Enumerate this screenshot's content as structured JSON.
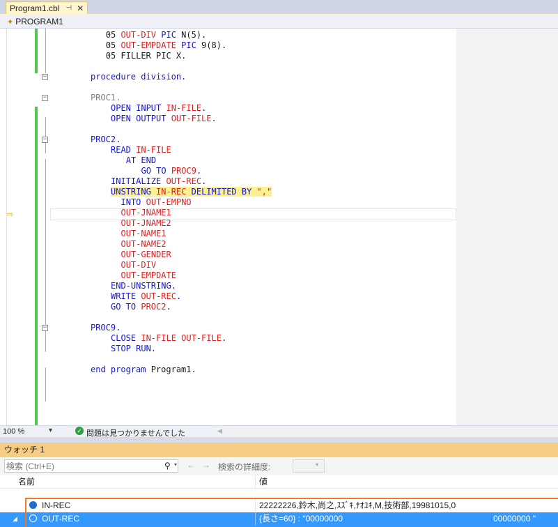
{
  "tab": {
    "title": "Program1.cbl",
    "pin_glyph": "⊣",
    "close_glyph": "✕"
  },
  "nav": {
    "scope": "PROGRAM1"
  },
  "editor": {
    "lines": [
      {
        "row": 1,
        "indent": 3,
        "segments": [
          [
            "pl",
            "05 "
          ],
          [
            "id",
            "OUT-DIV"
          ],
          [
            "kw",
            " PIC "
          ],
          [
            "pl",
            "N(5)."
          ]
        ]
      },
      {
        "row": 2,
        "indent": 3,
        "segments": [
          [
            "pl",
            "05 "
          ],
          [
            "id",
            "OUT-EMPDATE"
          ],
          [
            "kw",
            " PIC "
          ],
          [
            "pl",
            "9(8)."
          ]
        ]
      },
      {
        "row": 3,
        "indent": 3,
        "segments": [
          [
            "pl",
            "05 FILLER PIC X."
          ]
        ]
      },
      {
        "row": 5,
        "indent": 0,
        "segments": [
          [
            "kw",
            "procedure division."
          ]
        ]
      },
      {
        "row": 7,
        "indent": 0,
        "segments": [
          [
            "lb",
            "PROC1."
          ]
        ]
      },
      {
        "row": 8,
        "indent": 4,
        "segments": [
          [
            "kw",
            "OPEN INPUT "
          ],
          [
            "id",
            "IN-FILE"
          ],
          [
            "kw",
            "."
          ]
        ]
      },
      {
        "row": 9,
        "indent": 4,
        "segments": [
          [
            "kw",
            "OPEN OUTPUT "
          ],
          [
            "id",
            "OUT-FILE"
          ],
          [
            "kw",
            "."
          ]
        ]
      },
      {
        "row": 11,
        "indent": 0,
        "segments": [
          [
            "kw",
            "PROC2."
          ]
        ]
      },
      {
        "row": 12,
        "indent": 4,
        "segments": [
          [
            "kw",
            "READ "
          ],
          [
            "id",
            "IN-FILE"
          ]
        ]
      },
      {
        "row": 13,
        "indent": 7,
        "segments": [
          [
            "kw",
            "AT END"
          ]
        ]
      },
      {
        "row": 14,
        "indent": 10,
        "segments": [
          [
            "kw",
            "GO TO "
          ],
          [
            "id",
            "PROC9"
          ],
          [
            "kw",
            "."
          ]
        ]
      },
      {
        "row": 15,
        "indent": 4,
        "segments": [
          [
            "kw",
            "INITIALIZE "
          ],
          [
            "id",
            "OUT-REC"
          ],
          [
            "kw",
            "."
          ]
        ]
      },
      {
        "row": 16,
        "indent": 4,
        "highlight": true,
        "segments": [
          [
            "kw",
            "UNSTRING "
          ],
          [
            "id",
            "IN-REC"
          ],
          [
            "kw",
            " DELIMITED BY "
          ],
          [
            "id",
            "\",\""
          ]
        ]
      },
      {
        "row": 17,
        "indent": 6,
        "segments": [
          [
            "kw",
            "INTO "
          ],
          [
            "id",
            "OUT-EMPNO"
          ]
        ]
      },
      {
        "row": 18,
        "indent": 6,
        "segments": [
          [
            "id",
            "OUT-JNAME1"
          ]
        ]
      },
      {
        "row": 19,
        "indent": 6,
        "segments": [
          [
            "id",
            "OUT-JNAME2"
          ]
        ]
      },
      {
        "row": 20,
        "indent": 6,
        "segments": [
          [
            "id",
            "OUT-NAME1"
          ]
        ]
      },
      {
        "row": 21,
        "indent": 6,
        "segments": [
          [
            "id",
            "OUT-NAME2"
          ]
        ]
      },
      {
        "row": 22,
        "indent": 6,
        "segments": [
          [
            "id",
            "OUT-GENDER"
          ]
        ]
      },
      {
        "row": 23,
        "indent": 6,
        "segments": [
          [
            "id",
            "OUT-DIV"
          ]
        ]
      },
      {
        "row": 24,
        "indent": 6,
        "segments": [
          [
            "id",
            "OUT-EMPDATE"
          ]
        ]
      },
      {
        "row": 25,
        "indent": 4,
        "segments": [
          [
            "kw",
            "END-UNSTRING."
          ]
        ]
      },
      {
        "row": 26,
        "indent": 4,
        "segments": [
          [
            "kw",
            "WRITE "
          ],
          [
            "id",
            "OUT-REC"
          ],
          [
            "kw",
            "."
          ]
        ]
      },
      {
        "row": 27,
        "indent": 4,
        "segments": [
          [
            "kw",
            "GO TO "
          ],
          [
            "id",
            "PROC2"
          ],
          [
            "kw",
            "."
          ]
        ]
      },
      {
        "row": 29,
        "indent": 0,
        "segments": [
          [
            "kw",
            "PROC9."
          ]
        ]
      },
      {
        "row": 30,
        "indent": 4,
        "segments": [
          [
            "kw",
            "CLOSE "
          ],
          [
            "id",
            "IN-FILE OUT-FILE"
          ],
          [
            "kw",
            "."
          ]
        ]
      },
      {
        "row": 31,
        "indent": 4,
        "segments": [
          [
            "kw",
            "STOP RUN."
          ]
        ]
      },
      {
        "row": 33,
        "indent": 0,
        "segments": [
          [
            "kw",
            "end program "
          ],
          [
            "pl",
            "Program1"
          ],
          [
            "kw",
            "."
          ]
        ]
      }
    ],
    "fold_rows": [
      5,
      7,
      11,
      29
    ],
    "current_row": 16
  },
  "status": {
    "zoom": "100 %",
    "issues": "問題は見つかりませんでした"
  },
  "watch": {
    "title": "ウォッチ 1",
    "search_placeholder": "検索 (Ctrl+E)",
    "depth_label": "検索の詳細度:",
    "col_name": "名前",
    "col_value": "値",
    "rows": [
      {
        "name": "IN-REC",
        "value": "22222226,鈴木,尚之,ｽｽﾞｷ,ﾅｵﾕｷ,M,技術部,19981015,0",
        "value_tail": ""
      },
      {
        "name": "OUT-REC",
        "value": "{長さ=60} : \"00000000",
        "value_tail": "00000000 \""
      }
    ]
  },
  "colors": {
    "keyword": "#1414d6",
    "identifier": "#e01f1f",
    "label": "#808080",
    "watch_title": "#f5cc84",
    "selection": "#3399ff",
    "callout": "#f0772a"
  }
}
